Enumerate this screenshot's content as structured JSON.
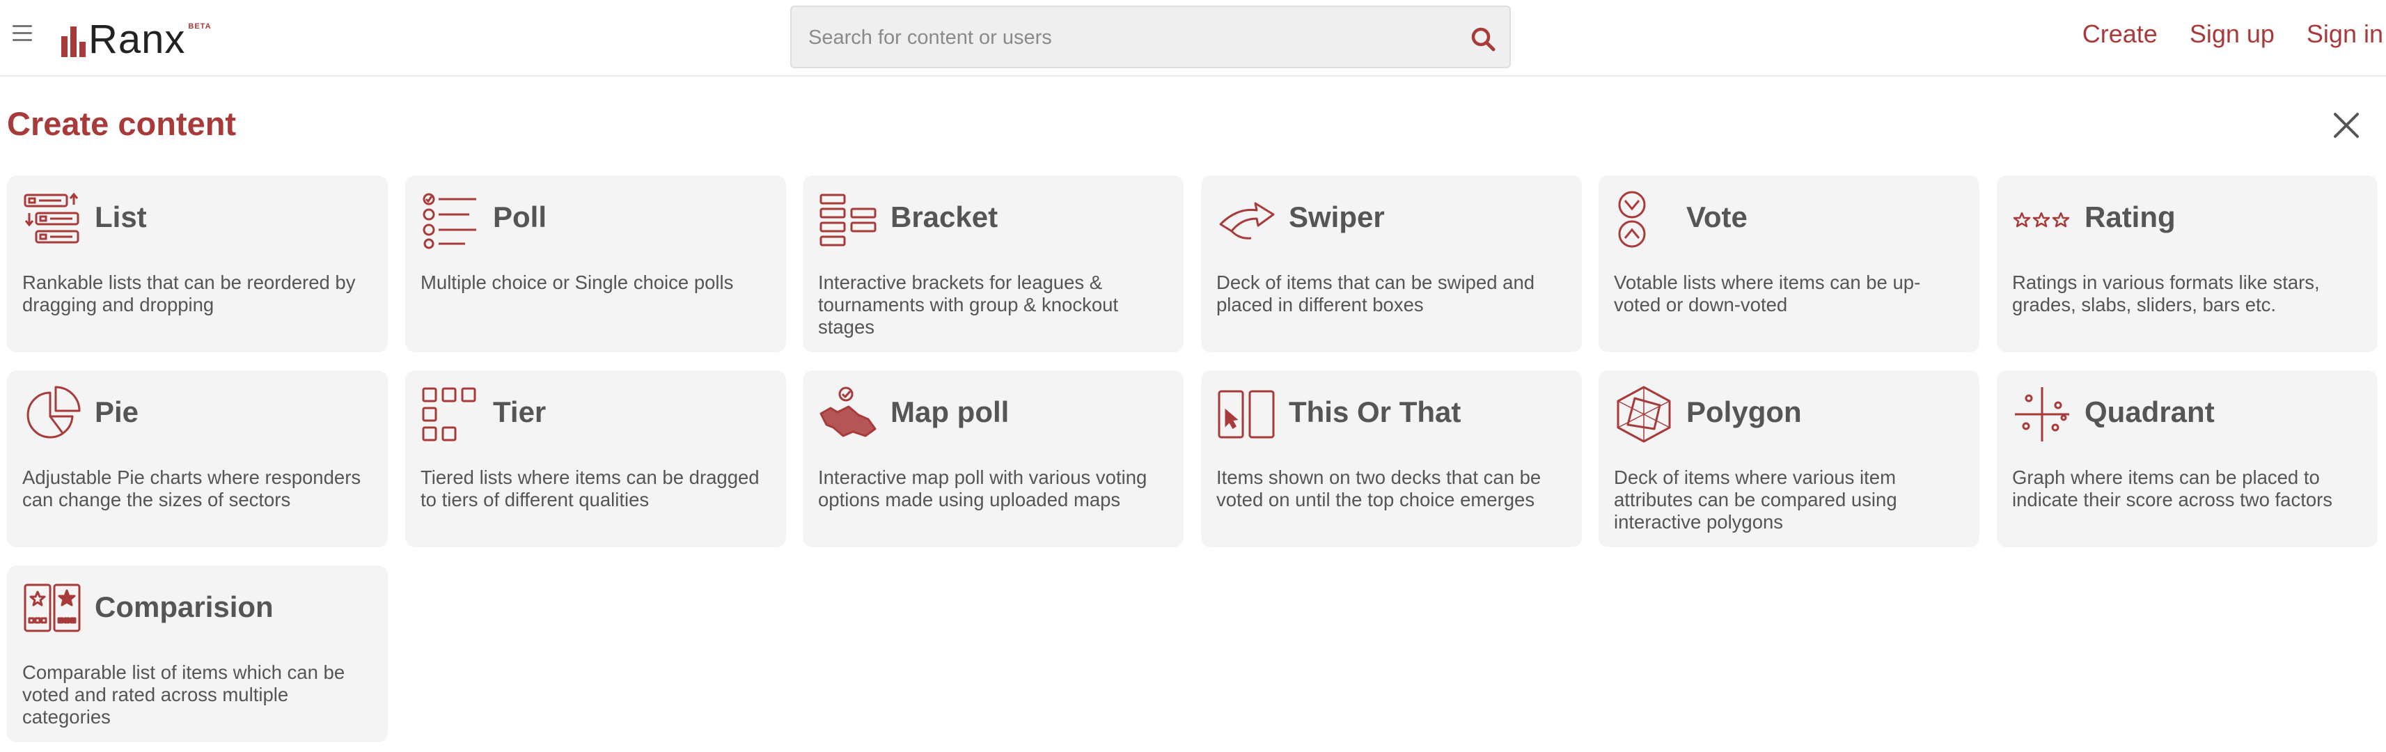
{
  "header": {
    "logo_text": "Ranx",
    "logo_badge": "BETA",
    "search": {
      "placeholder": "Search for content or users",
      "value": ""
    },
    "nav": {
      "create": "Create",
      "signup": "Sign up",
      "signin": "Sign in"
    }
  },
  "page": {
    "title": "Create content"
  },
  "cards": [
    {
      "title": "List",
      "desc": "Rankable lists that can be reordered by dragging and dropping",
      "icon": "list-icon"
    },
    {
      "title": "Poll",
      "desc": "Multiple choice or Single choice polls",
      "icon": "poll-icon"
    },
    {
      "title": "Bracket",
      "desc": "Interactive brackets for leagues & tournaments with group & knockout stages",
      "icon": "bracket-icon"
    },
    {
      "title": "Swiper",
      "desc": "Deck of items that can be swiped and placed in different boxes",
      "icon": "swiper-icon"
    },
    {
      "title": "Vote",
      "desc": "Votable lists where items can be up-voted or down-voted",
      "icon": "vote-icon"
    },
    {
      "title": "Rating",
      "desc": "Ratings in various formats like stars, grades, slabs, sliders, bars etc.",
      "icon": "rating-icon"
    },
    {
      "title": "Pie",
      "desc": "Adjustable Pie charts where responders can change the sizes of sectors",
      "icon": "pie-icon"
    },
    {
      "title": "Tier",
      "desc": "Tiered lists where items can be dragged to tiers of different qualities",
      "icon": "tier-icon"
    },
    {
      "title": "Map poll",
      "desc": "Interactive map poll with various voting options made using uploaded maps",
      "icon": "map-poll-icon"
    },
    {
      "title": "This Or That",
      "desc": "Items shown on two decks that can be voted on until the top choice emerges",
      "icon": "this-or-that-icon"
    },
    {
      "title": "Polygon",
      "desc": "Deck of items where various item attributes can be compared using interactive polygons",
      "icon": "polygon-icon"
    },
    {
      "title": "Quadrant",
      "desc": "Graph where items can be placed to indicate their score across two factors",
      "icon": "quadrant-icon"
    },
    {
      "title": "Comparision",
      "desc": "Comparable list of items which can be voted and rated across multiple categories",
      "icon": "comparison-icon"
    }
  ],
  "colors": {
    "accent": "#a83a3a",
    "card_bg": "#f4f4f4",
    "text": "#555555"
  }
}
